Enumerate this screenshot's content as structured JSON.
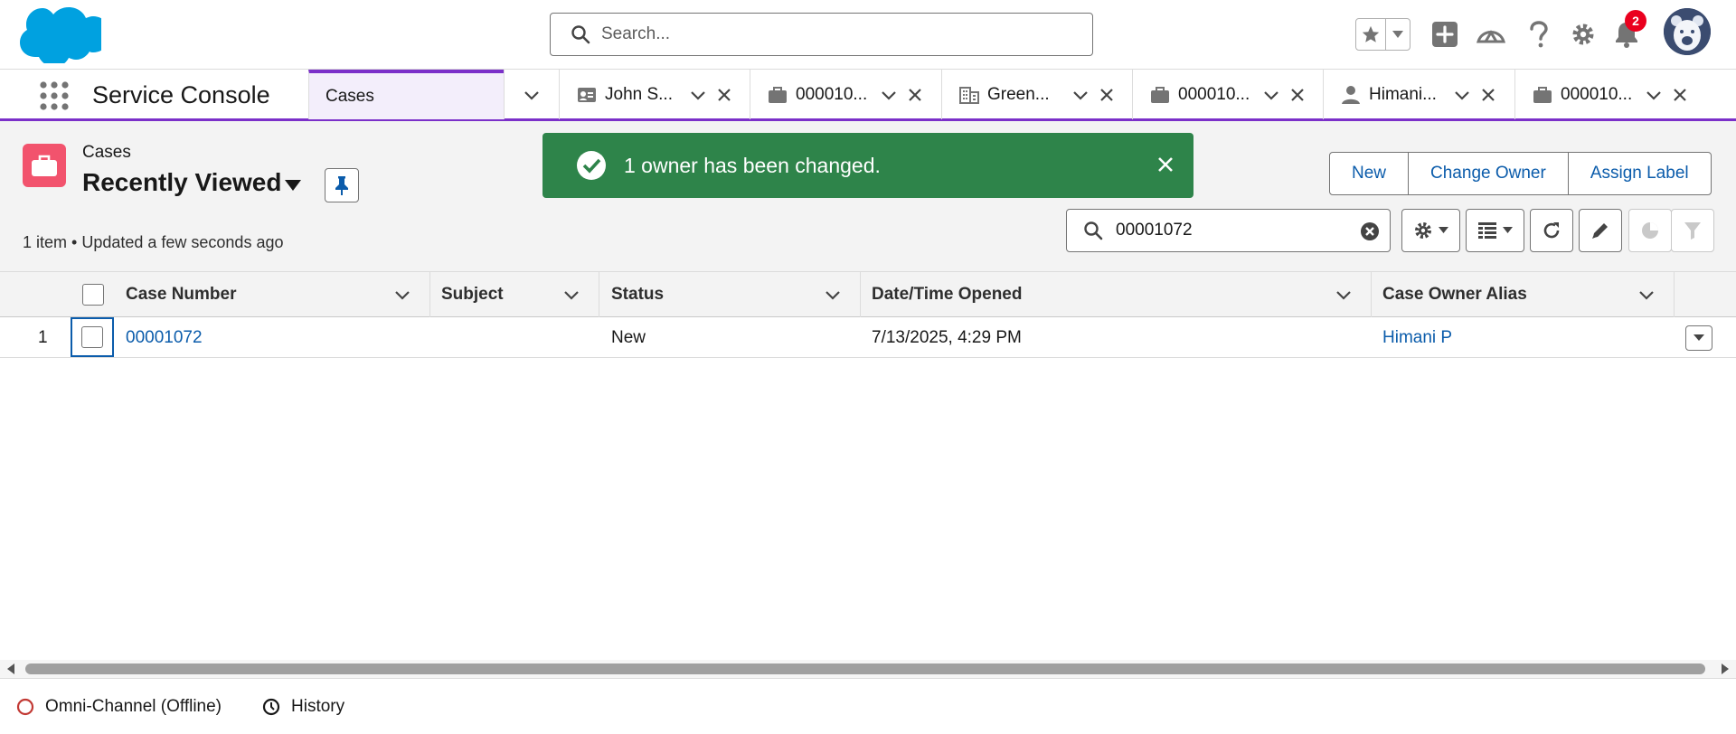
{
  "header": {
    "search_placeholder": "Search...",
    "notification_count": "2"
  },
  "nav": {
    "app_name": "Service Console",
    "tabs": [
      {
        "label": "Cases",
        "icon": "chevron-down-icon",
        "active": true
      },
      {
        "label": "John S...",
        "icon": "contact-card-icon"
      },
      {
        "label": "000010...",
        "icon": "case-briefcase-icon"
      },
      {
        "label": "Green...",
        "icon": "account-building-icon"
      },
      {
        "label": "000010...",
        "icon": "case-briefcase-icon"
      },
      {
        "label": "Himani...",
        "icon": "user-icon"
      },
      {
        "label": "000010...",
        "icon": "case-briefcase-icon"
      }
    ]
  },
  "list": {
    "object_label": "Cases",
    "view_name": "Recently Viewed",
    "meta": "1 item • Updated a few seconds ago",
    "search_value": "00001072"
  },
  "toast": {
    "message": "1 owner has been changed.",
    "color": "#2e844a"
  },
  "actions": [
    "New",
    "Change Owner",
    "Assign Label"
  ],
  "table": {
    "columns": [
      "Case Number",
      "Subject",
      "Status",
      "Date/Time Opened",
      "Case Owner Alias"
    ],
    "rows": [
      {
        "index": "1",
        "case_number": "00001072",
        "subject": "",
        "status": "New",
        "opened": "7/13/2025, 4:29 PM",
        "owner": "Himani P"
      }
    ]
  },
  "footer": {
    "omni": "Omni-Channel (Offline)",
    "history": "History"
  },
  "colors": {
    "accent": "#7b30c9",
    "link": "#0b5cab",
    "case_icon": "#f2536d",
    "brand_cloud": "#00a1e0"
  }
}
